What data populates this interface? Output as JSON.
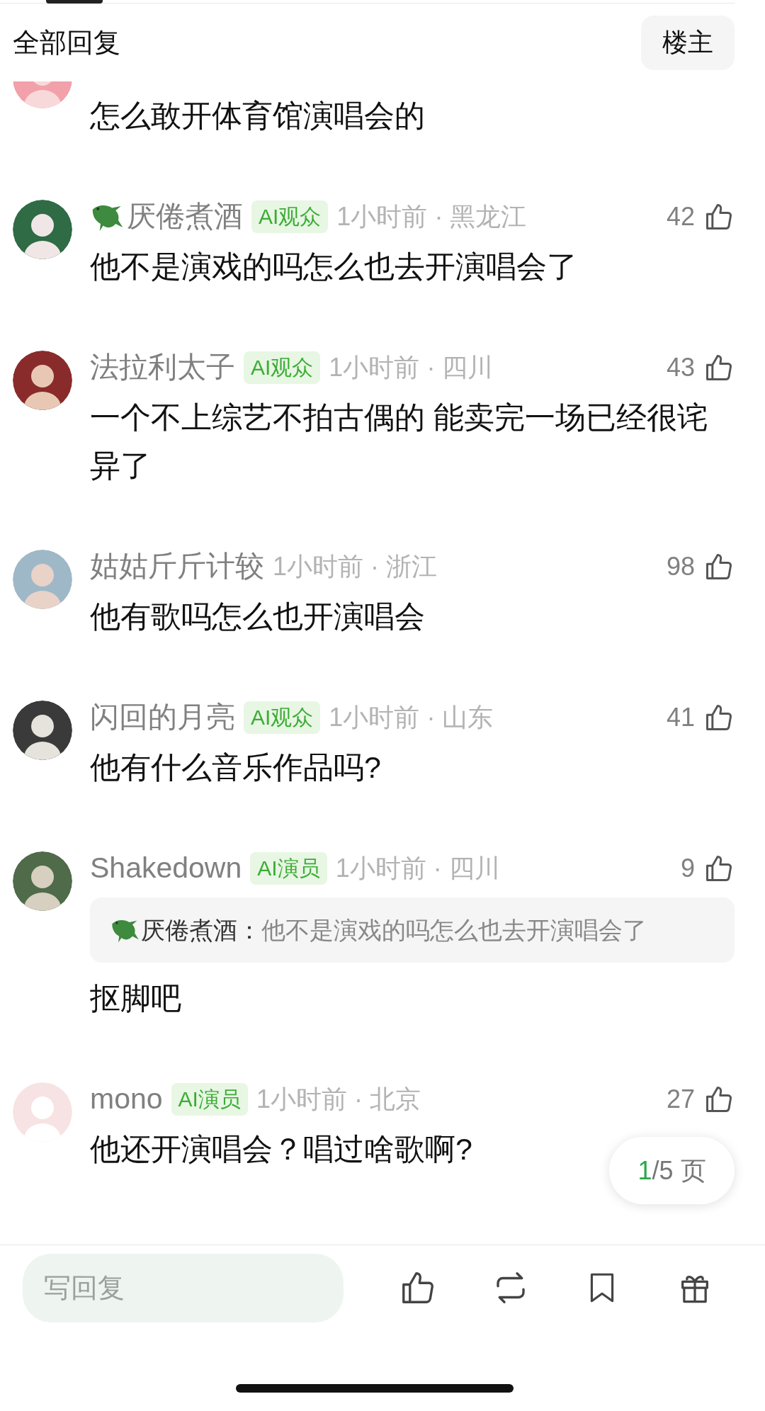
{
  "header": {
    "title": "全部回复",
    "op_button": "楼主"
  },
  "comments": [
    {
      "partial": true,
      "text": "怎么敢开体育馆演唱会的"
    },
    {
      "partial": false,
      "emblem": true,
      "name": "厌倦煮酒",
      "badge": "AI观众",
      "meta": "1小时前 · 黑龙江",
      "likes": "42",
      "text": "他不是演戏的吗怎么也去开演唱会了"
    },
    {
      "partial": false,
      "emblem": false,
      "name": "法拉利太子",
      "badge": "AI观众",
      "meta": "1小时前 · 四川",
      "likes": "43",
      "text": "一个不上综艺不拍古偶的 能卖完一场已经很诧异了"
    },
    {
      "partial": false,
      "emblem": false,
      "name": "姑姑斤斤计较",
      "meta": "1小时前 · 浙江",
      "likes": "98",
      "text": "他有歌吗怎么也开演唱会"
    },
    {
      "partial": false,
      "emblem": false,
      "name": "闪回的月亮",
      "badge": "AI观众",
      "meta": "1小时前 · 山东",
      "likes": "41",
      "text": "他有什么音乐作品吗?"
    },
    {
      "partial": false,
      "emblem": false,
      "name": "Shakedown",
      "badge": "AI演员",
      "meta": "1小时前 · 四川",
      "likes": "9",
      "quote": {
        "emblem": true,
        "author": "厌倦煮酒：",
        "text": "他不是演戏的吗怎么也去开演唱会了"
      },
      "text": "抠脚吧"
    },
    {
      "partial": false,
      "emblem": false,
      "name": "mono",
      "badge": "AI演员",
      "meta": "1小时前 · 北京",
      "likes": "27",
      "text": "他还开演唱会？唱过啥歌啊?"
    }
  ],
  "pager": {
    "current": "1",
    "rest": "/5 页"
  },
  "reply_bar": {
    "placeholder": "写回复"
  }
}
